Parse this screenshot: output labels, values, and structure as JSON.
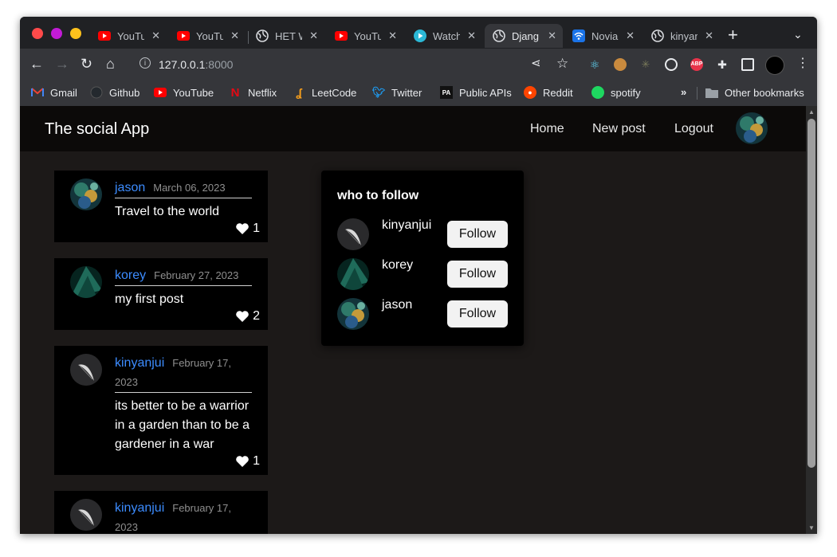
{
  "browser": {
    "tabs": [
      {
        "title": "YouTube",
        "icon": "youtube-icon",
        "active": false
      },
      {
        "title": "YouTube",
        "icon": "youtube-icon",
        "active": false
      },
      {
        "title": "HET W",
        "icon": "globe-icon",
        "active": false
      },
      {
        "title": "YouTube",
        "icon": "youtube-icon",
        "active": false
      },
      {
        "title": "Watch",
        "icon": "play-circle-icon",
        "active": false
      },
      {
        "title": "Django",
        "icon": "globe-icon",
        "active": true
      },
      {
        "title": "Novia",
        "icon": "wifi-icon",
        "active": false
      },
      {
        "title": "kinyanjui",
        "icon": "globe-icon",
        "active": false
      }
    ],
    "url_host": "127.0.0.1",
    "url_port": ":8000",
    "bookmarks": [
      {
        "label": "Gmail",
        "icon": "gmail-icon"
      },
      {
        "label": "Github",
        "icon": "github-icon"
      },
      {
        "label": "YouTube",
        "icon": "youtube-icon"
      },
      {
        "label": "Netflix",
        "icon": "netflix-icon"
      },
      {
        "label": "LeetCode",
        "icon": "leetcode-icon"
      },
      {
        "label": "Twitter",
        "icon": "twitter-icon"
      },
      {
        "label": "Public APIs",
        "icon": "public-apis-icon"
      },
      {
        "label": "Reddit",
        "icon": "reddit-icon"
      },
      {
        "label": "spotify",
        "icon": "spotify-icon"
      }
    ],
    "other_bookmarks": "Other bookmarks",
    "extensions": [
      "react-devtools-icon",
      "cookie-icon",
      "spider-icon",
      "target-icon",
      "adblock-icon",
      "puzzle-icon",
      "sidepanel-icon",
      "profile-avatar-icon",
      "kebab-menu-icon"
    ]
  },
  "app": {
    "brand": "The social App",
    "nav": {
      "home": "Home",
      "new_post": "New post",
      "logout": "Logout"
    }
  },
  "posts": [
    {
      "user": "jason",
      "date": "March 06, 2023",
      "text": "Travel to the world",
      "likes": "1",
      "avatar": "landscape"
    },
    {
      "user": "korey",
      "date": "February 27, 2023",
      "text": "my first post",
      "likes": "2",
      "avatar": "teal"
    },
    {
      "user": "kinyanjui",
      "date": "February 17, 2023",
      "text": "its better to be a warrior in a garden than to be a gardener in a war",
      "likes": "1",
      "avatar": "feather"
    },
    {
      "user": "kinyanjui",
      "date": "February 17, 2023",
      "text": "",
      "likes": "",
      "avatar": "feather"
    }
  ],
  "who_to_follow": {
    "title": "who to follow",
    "button_label": "Follow",
    "users": [
      {
        "name": "kinyanjui",
        "avatar": "feather"
      },
      {
        "name": "korey",
        "avatar": "teal"
      },
      {
        "name": "jason",
        "avatar": "landscape"
      }
    ]
  },
  "colors": {
    "username": "#3c8cff",
    "page_bg": "#1c1918",
    "card_bg": "#000000",
    "navbar_bg": "#0c0a09"
  }
}
